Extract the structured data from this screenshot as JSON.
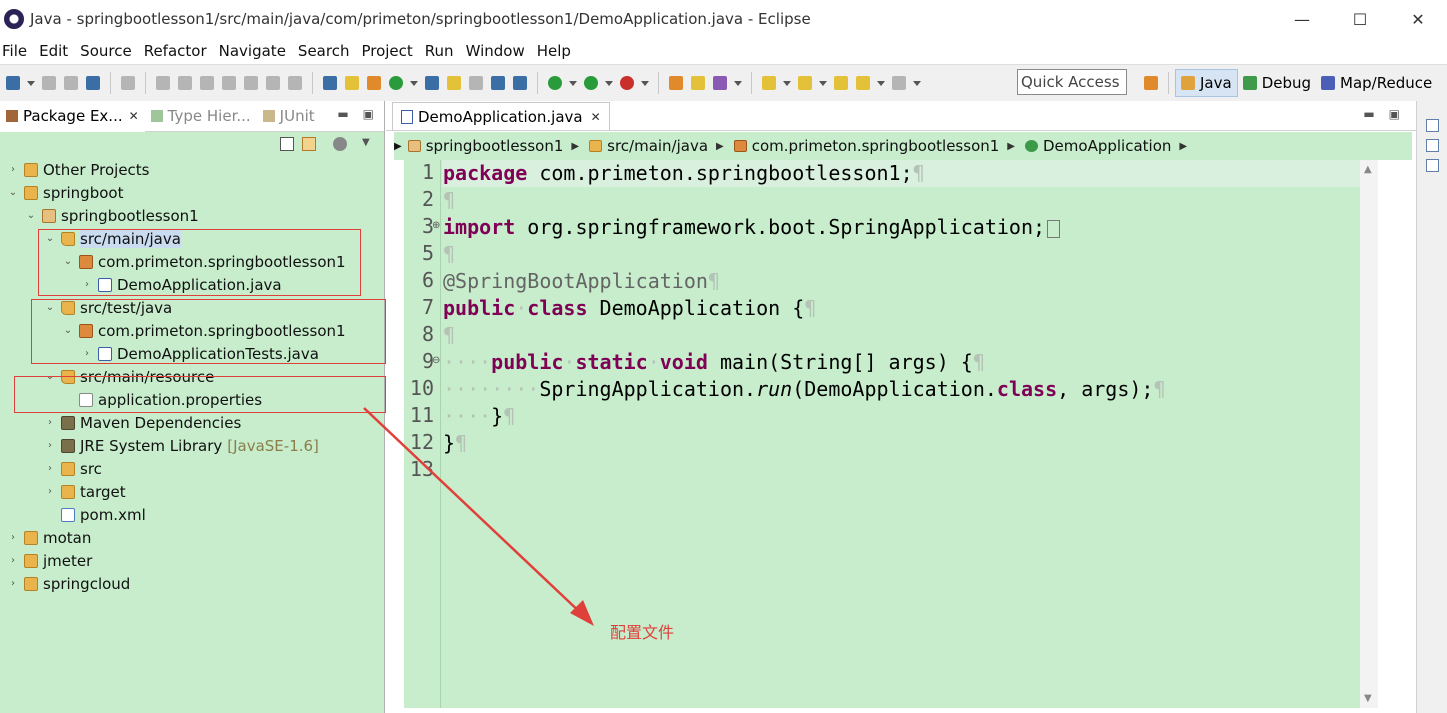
{
  "window": {
    "title": "Java - springbootlesson1/src/main/java/com/primeton/springbootlesson1/DemoApplication.java - Eclipse",
    "minimize": "—",
    "maximize": "☐",
    "close": "✕"
  },
  "menu": [
    "File",
    "Edit",
    "Source",
    "Refactor",
    "Navigate",
    "Search",
    "Project",
    "Run",
    "Window",
    "Help"
  ],
  "toolbar": {
    "quick_access": "Quick Access",
    "perspectives": [
      {
        "label": "Java",
        "active": true
      },
      {
        "label": "Debug",
        "active": false
      },
      {
        "label": "Map/Reduce",
        "active": false
      }
    ]
  },
  "left_panel": {
    "tabs": [
      {
        "label": "Package Ex...",
        "active": true
      },
      {
        "label": "Type Hier...",
        "active": false
      },
      {
        "label": "JUnit",
        "active": false
      }
    ],
    "tree": [
      {
        "label": "Other Projects",
        "twisty": "›",
        "icon": "folder"
      },
      {
        "label": "springboot",
        "twisty": "⌄",
        "icon": "folder"
      },
      {
        "label": "springbootlesson1",
        "twisty": "⌄",
        "icon": "project"
      },
      {
        "label": "src/main/java",
        "twisty": "⌄",
        "icon": "srcfolder"
      },
      {
        "label": "com.primeton.springbootlesson1",
        "twisty": "⌄",
        "icon": "pkg"
      },
      {
        "label": "DemoApplication.java",
        "twisty": "›",
        "icon": "java"
      },
      {
        "label": "src/test/java",
        "twisty": "⌄",
        "icon": "srcfolder"
      },
      {
        "label": "com.primeton.springbootlesson1",
        "twisty": "⌄",
        "icon": "pkg"
      },
      {
        "label": "DemoApplicationTests.java",
        "twisty": "›",
        "icon": "java"
      },
      {
        "label": "src/main/resource",
        "twisty": "⌄",
        "icon": "srcfolder"
      },
      {
        "label": "application.properties",
        "twisty": "",
        "icon": "file"
      },
      {
        "label": "Maven Dependencies",
        "twisty": "›",
        "icon": "lib"
      },
      {
        "label": "JRE System Library",
        "suffix": "[JavaSE-1.6]",
        "twisty": "›",
        "icon": "lib"
      },
      {
        "label": "src",
        "twisty": "›",
        "icon": "folder"
      },
      {
        "label": "target",
        "twisty": "›",
        "icon": "folder"
      },
      {
        "label": "pom.xml",
        "twisty": "",
        "icon": "xml"
      },
      {
        "label": "motan",
        "twisty": "›",
        "icon": "folder"
      },
      {
        "label": "jmeter",
        "twisty": "›",
        "icon": "folder"
      },
      {
        "label": "springcloud",
        "twisty": "›",
        "icon": "folder"
      }
    ]
  },
  "editor": {
    "tab_label": "DemoApplication.java",
    "breadcrumb": [
      "springbootlesson1",
      "src/main/java",
      "com.primeton.springbootlesson1",
      "DemoApplication"
    ],
    "line_numbers": [
      "1",
      "2",
      "3",
      "5",
      "6",
      "7",
      "8",
      "9",
      "10",
      "11",
      "12",
      "13"
    ],
    "code": {
      "l1_kw": "package",
      "l1_rest": " com.primeton.springbootlesson1;",
      "l3_kw": "import",
      "l3_rest": " org.springframework.boot.SpringApplication;",
      "l6_ann": "@SpringBootApplication",
      "l7_kw1": "public",
      "l7_kw2": "class",
      "l7_rest": " DemoApplication {",
      "l9_kw1": "public",
      "l9_kw2": "static",
      "l9_kw3": "void",
      "l9_rest": " main(String[] args) {",
      "l10_pre": "SpringApplication.",
      "l10_method": "run",
      "l10_mid": "(DemoApplication.",
      "l10_kw": "class",
      "l10_post": ", args);",
      "l11": "}",
      "l12": "}"
    },
    "pilcrow": "¶",
    "indent_dots_4": "····",
    "indent_dots_8": "········"
  },
  "annotation": {
    "label": "配置文件",
    "color": "#e0403a"
  },
  "colors": {
    "editor_bg": "#c7edcc",
    "keyword": "#7f0055",
    "annotation_text": "#646464"
  }
}
